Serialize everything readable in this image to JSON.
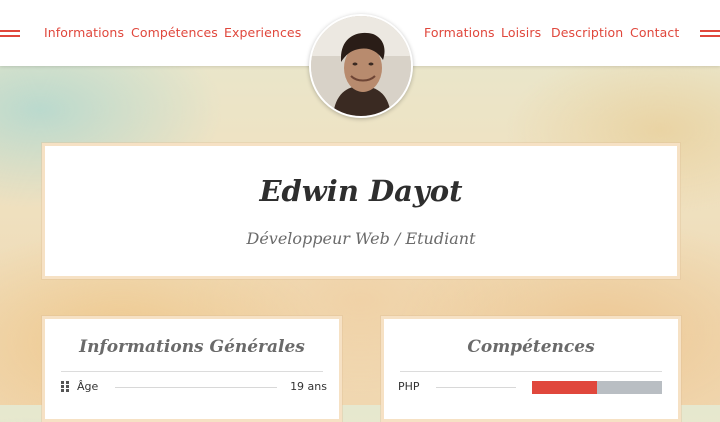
{
  "nav": {
    "left": [
      "Informations",
      "Compétences",
      "Experiences"
    ],
    "right": [
      "Formations",
      "Loisirs",
      "Description",
      "Contact"
    ]
  },
  "colors": {
    "accent": "#e0473c",
    "bar_track": "#b9bec3"
  },
  "icons": {
    "menu_left": "menu-lines-icon",
    "menu_right": "menu-lines-icon",
    "age": "grid-dots-icon"
  },
  "hero": {
    "name": "Edwin Dayot",
    "subtitle": "Développeur Web  / Etudiant"
  },
  "info": {
    "title": "Informations Générales",
    "row": {
      "label": "Âge",
      "value": "19 ans"
    }
  },
  "skills": {
    "title": "Compétences",
    "items": [
      {
        "label": "PHP",
        "level": 0.5
      }
    ]
  }
}
